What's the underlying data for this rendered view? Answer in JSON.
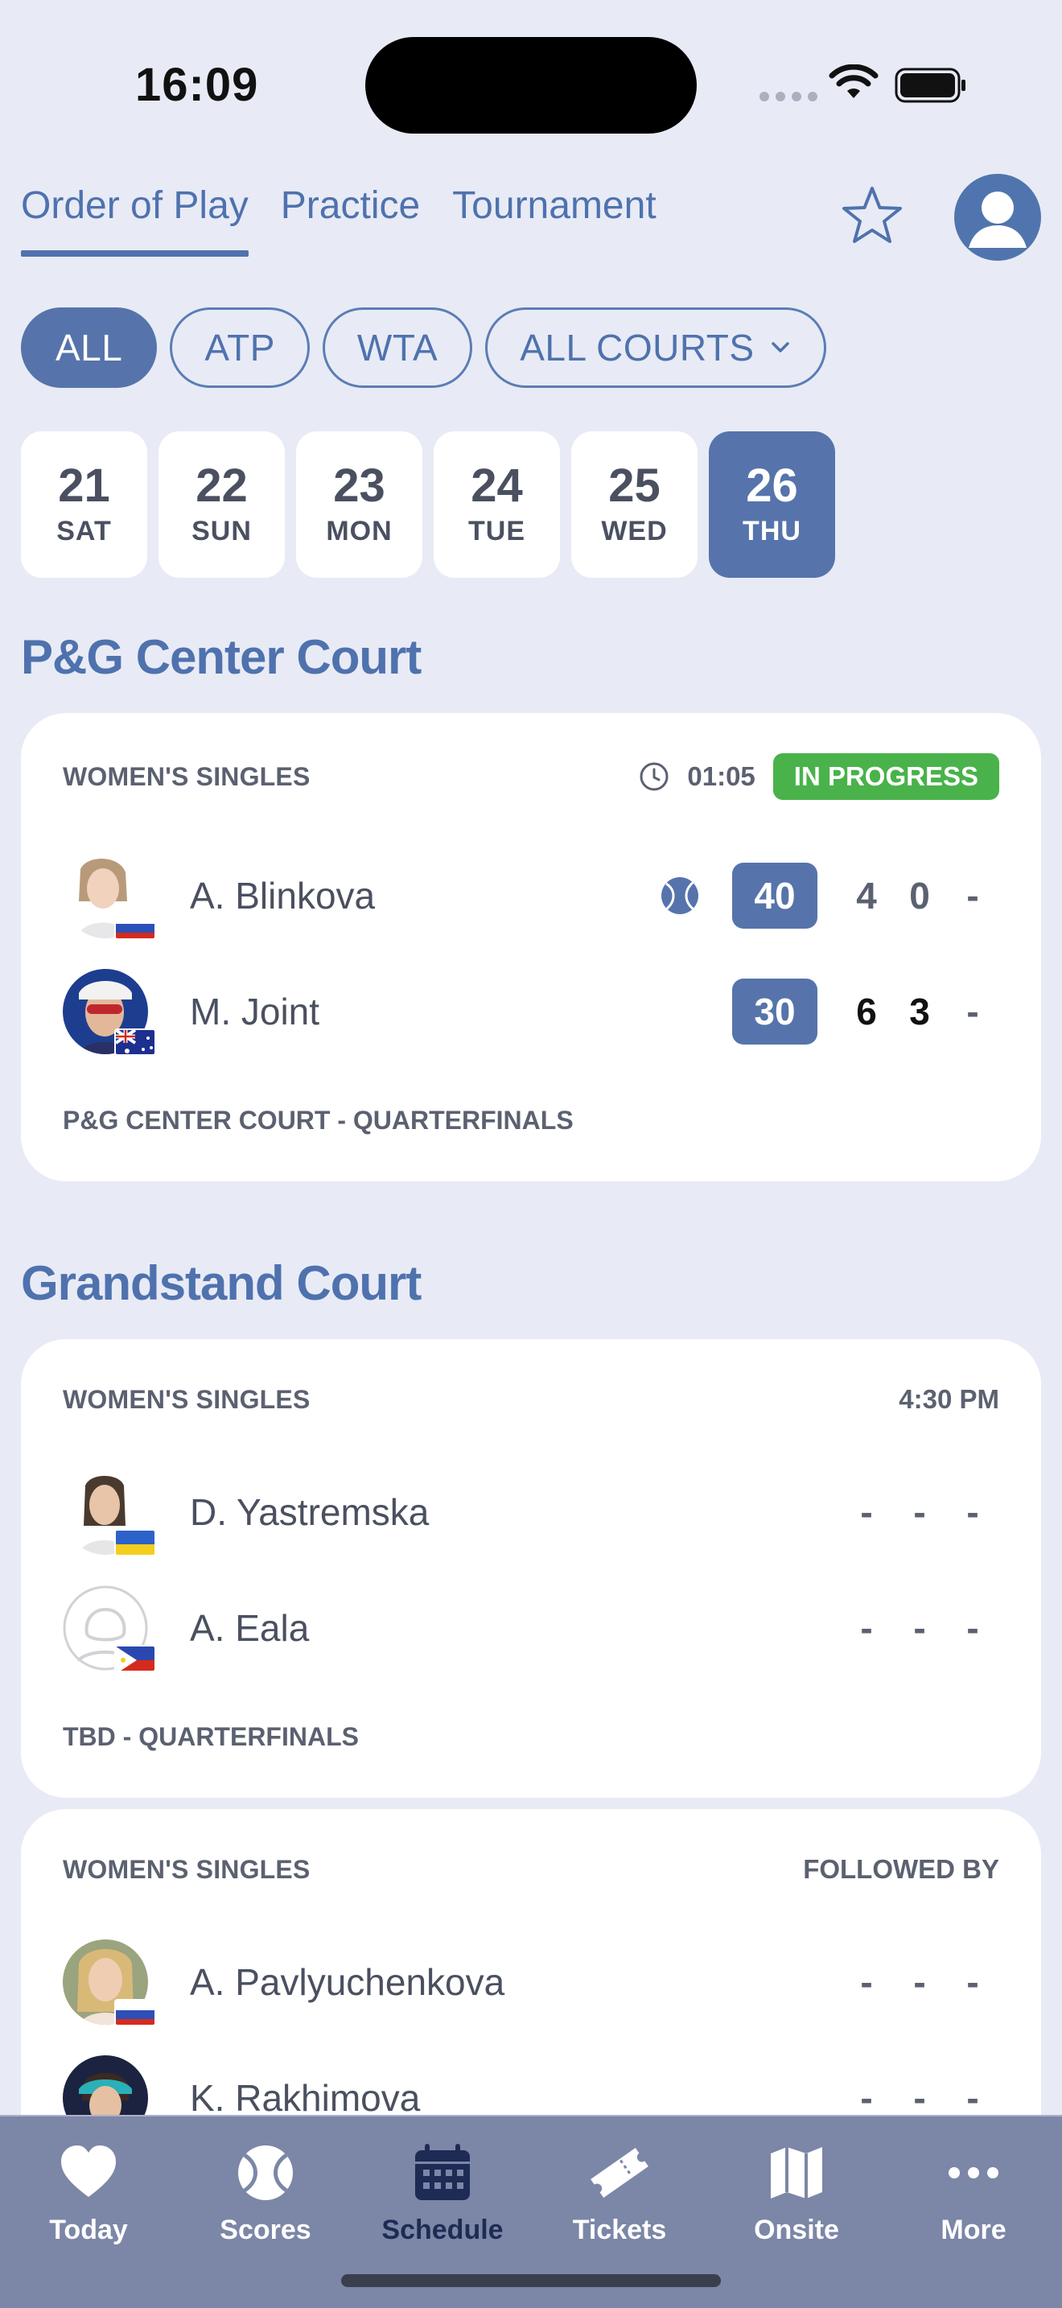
{
  "status_bar": {
    "time": "16:09"
  },
  "top_tabs": [
    {
      "label": "Order of Play",
      "active": true
    },
    {
      "label": "Practice",
      "active": false
    },
    {
      "label": "Tournament",
      "active": false
    }
  ],
  "header_icons": [
    "star-icon",
    "profile-icon"
  ],
  "filters": [
    {
      "label": "ALL",
      "active": true
    },
    {
      "label": "ATP",
      "active": false
    },
    {
      "label": "WTA",
      "active": false
    },
    {
      "label": "ALL COURTS",
      "active": false,
      "dropdown": true
    }
  ],
  "dates": [
    {
      "num": "21",
      "dow": "SAT"
    },
    {
      "num": "22",
      "dow": "SUN"
    },
    {
      "num": "23",
      "dow": "MON"
    },
    {
      "num": "24",
      "dow": "TUE"
    },
    {
      "num": "25",
      "dow": "WED"
    },
    {
      "num": "26",
      "dow": "THU",
      "active": true
    }
  ],
  "courts": [
    {
      "name": "P&G Center Court",
      "matches": [
        {
          "event": "WOMEN'S SINGLES",
          "time": "01:05",
          "status": "IN PROGRESS",
          "footer": "P&G CENTER COURT - QUARTERFINALS",
          "players": [
            {
              "name": "A. Blinkova",
              "flag": "RUS",
              "serving": true,
              "game": "40",
              "sets": [
                "4",
                "0",
                "-"
              ]
            },
            {
              "name": "M. Joint",
              "flag": "AUS",
              "serving": false,
              "game": "30",
              "sets": [
                "6",
                "3",
                "-"
              ]
            }
          ]
        }
      ]
    },
    {
      "name": "Grandstand Court",
      "matches": [
        {
          "event": "WOMEN'S SINGLES",
          "time": "4:30 PM",
          "footer": "TBD - QUARTERFINALS",
          "players": [
            {
              "name": "D. Yastremska",
              "flag": "UKR",
              "sets": [
                "-",
                "-",
                "-"
              ]
            },
            {
              "name": "A. Eala",
              "flag": "PHI",
              "sets": [
                "-",
                "-",
                "-"
              ]
            }
          ]
        },
        {
          "event": "WOMEN'S SINGLES",
          "time": "FOLLOWED BY",
          "players": [
            {
              "name": "A. Pavlyuchenkova",
              "flag": "RUS",
              "sets": [
                "-",
                "-",
                "-"
              ]
            },
            {
              "name": "K. Rakhimova",
              "flag": "RUS",
              "sets": [
                "-",
                "-",
                "-"
              ]
            }
          ]
        }
      ]
    }
  ],
  "bottom_nav": [
    {
      "label": "Today",
      "icon": "heart-icon"
    },
    {
      "label": "Scores",
      "icon": "tennis-ball-icon"
    },
    {
      "label": "Schedule",
      "icon": "calendar-icon",
      "active": true
    },
    {
      "label": "Tickets",
      "icon": "ticket-icon"
    },
    {
      "label": "Onsite",
      "icon": "map-icon"
    },
    {
      "label": "More",
      "icon": "more-icon"
    }
  ],
  "colors": {
    "background": "#e8ebf5",
    "accent": "#4f72ae",
    "accent_fill": "#5674ab",
    "status_green": "#49b24a",
    "nav_bg": "#7c86a7"
  }
}
